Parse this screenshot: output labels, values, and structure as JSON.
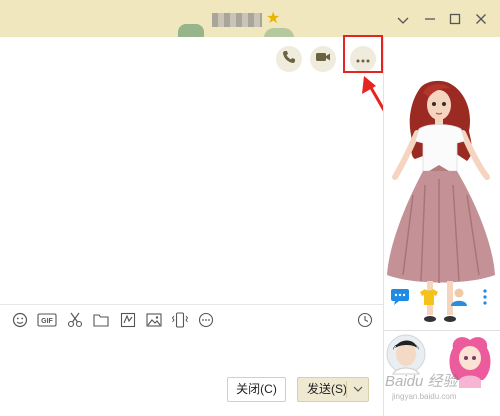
{
  "titlebar": {
    "title_blurred": "",
    "minimize_icon": "minimize-icon",
    "maximize_icon": "maximize-icon",
    "close_icon": "close-icon",
    "menu_icon": "chevron-down-icon"
  },
  "header_actions": [
    {
      "name": "voice-call-button",
      "icon": "phone-icon"
    },
    {
      "name": "video-call-button",
      "icon": "video-camera-icon"
    },
    {
      "name": "more-button",
      "icon": "ellipsis-icon"
    }
  ],
  "toolbar": [
    {
      "name": "emoji-button",
      "icon": "smiley-icon"
    },
    {
      "name": "gif-button",
      "icon": "gif-icon",
      "label": "GIF"
    },
    {
      "name": "screenshot-button",
      "icon": "scissors-icon"
    },
    {
      "name": "file-button",
      "icon": "folder-icon"
    },
    {
      "name": "doodle-button",
      "icon": "doodle-icon"
    },
    {
      "name": "image-button",
      "icon": "image-icon"
    },
    {
      "name": "shake-button",
      "icon": "vibrate-icon"
    },
    {
      "name": "more-tools-button",
      "icon": "ellipsis-icon"
    },
    {
      "name": "history-button",
      "icon": "clock-icon"
    }
  ],
  "footer": {
    "close_label": "关闭(C)",
    "send_label": "发送(S)"
  },
  "right_panel": {
    "icons": [
      "chat-bubble-icon",
      "tshirt-icon",
      "avatar-icon",
      "more-vertical-icon"
    ]
  },
  "watermark": {
    "text": "Baidu 经验",
    "sub": "jingyan.baidu.com"
  },
  "colors": {
    "titlebar": "#f1e7bf",
    "highlight": "#e52421",
    "send_button": "#f0e9d1",
    "accent_blue": "#1e8be6"
  }
}
